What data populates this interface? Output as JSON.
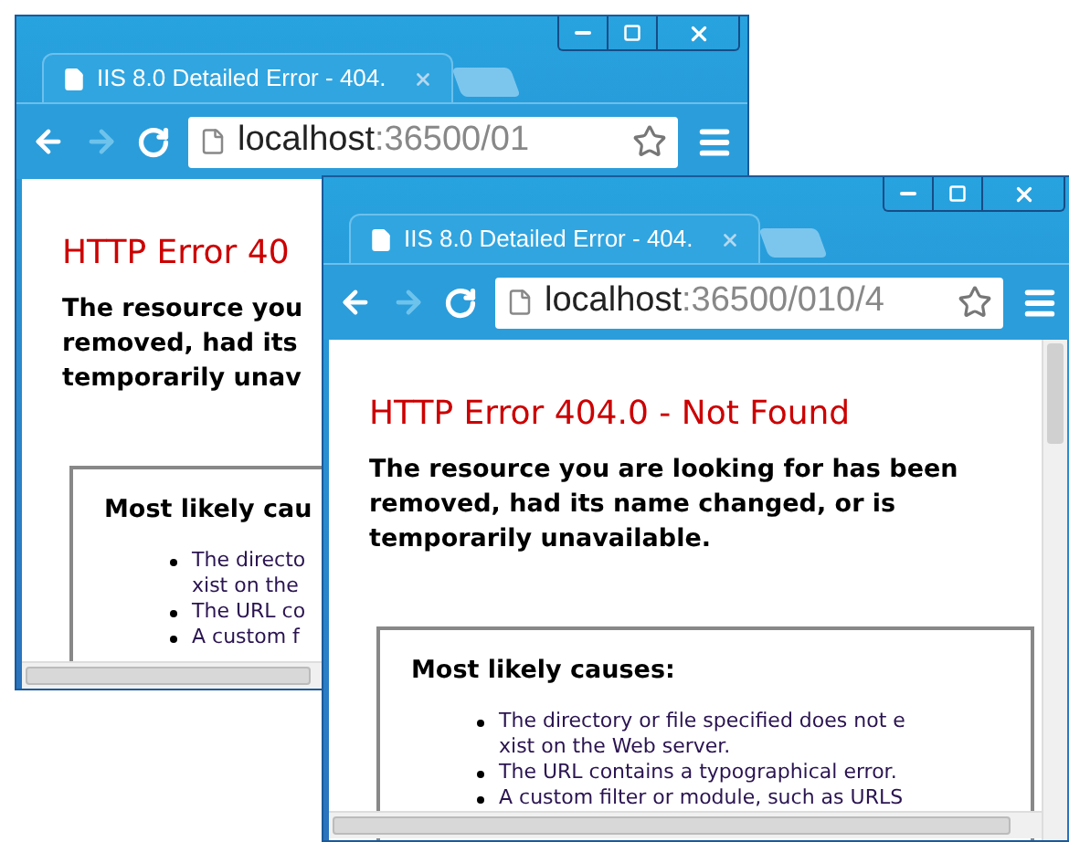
{
  "windows": [
    {
      "tab_title": "IIS 8.0 Detailed Error - 404.",
      "url_host": "localhost",
      "url_path": ":36500/01",
      "forward_enabled": false,
      "heading": "HTTP Error 40",
      "message_lines": [
        "The resource you",
        "removed, had its",
        "temporarily unav"
      ],
      "causes_title": "Most likely cau",
      "causes": [
        {
          "lines": [
            "The directo",
            "xist on the"
          ]
        },
        {
          "lines": [
            "The URL co"
          ]
        },
        {
          "lines": [
            "A custom f"
          ]
        }
      ]
    },
    {
      "tab_title": "IIS 8.0 Detailed Error - 404.",
      "url_host": "localhost",
      "url_path": ":36500/010/4",
      "forward_enabled": false,
      "heading": "HTTP Error 404.0 - Not Found",
      "message_lines": [
        "The resource you are looking for has been",
        "removed, had its name changed, or is",
        "temporarily unavailable."
      ],
      "causes_title": "Most likely causes:",
      "causes": [
        {
          "lines": [
            "The directory or file specified does not e",
            "xist on the Web server."
          ]
        },
        {
          "lines": [
            "The URL contains a typographical error."
          ]
        },
        {
          "lines": [
            "A custom filter or module, such as URLS"
          ]
        }
      ]
    }
  ]
}
